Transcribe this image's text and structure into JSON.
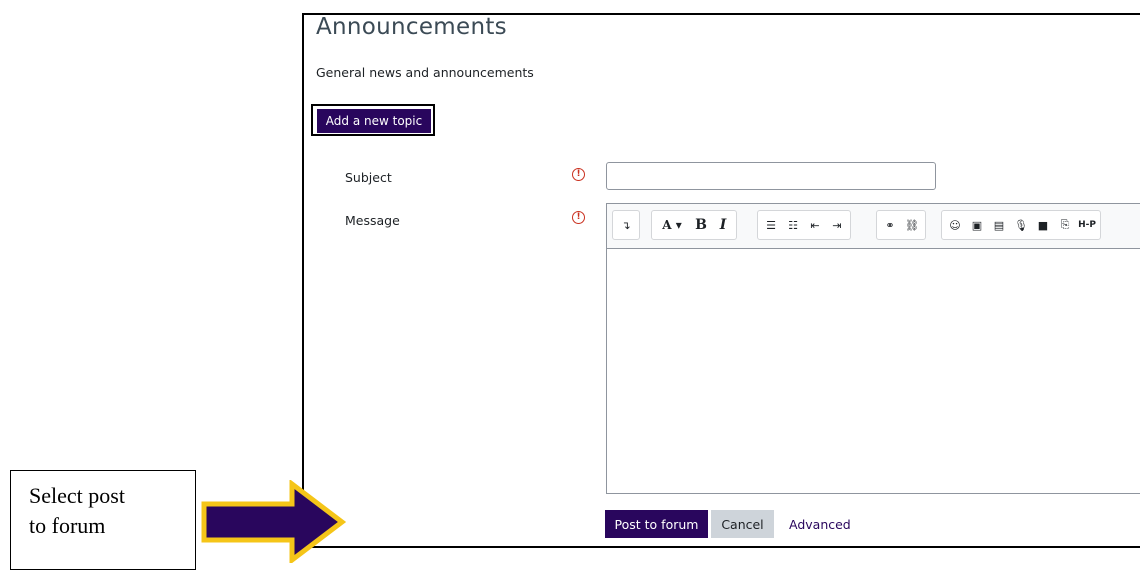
{
  "page": {
    "title": "Announcements",
    "description": "General news and announcements"
  },
  "actions": {
    "add_topic_label": "Add a new topic"
  },
  "form": {
    "subject_label": "Subject",
    "subject_value": "",
    "message_label": "Message",
    "required_icon": "exclamation-circle-icon",
    "required_color": "#ca3120"
  },
  "editor": {
    "toolbar_groups": [
      {
        "name": "collapse",
        "buttons": [
          {
            "icon": "collapse-icon",
            "glyph": "↴"
          }
        ]
      },
      {
        "name": "format",
        "buttons": [
          {
            "icon": "font-style-icon",
            "glyph": "A ▾"
          },
          {
            "icon": "bold-icon",
            "glyph": "B"
          },
          {
            "icon": "italic-icon",
            "glyph": "I"
          }
        ]
      },
      {
        "name": "lists",
        "buttons": [
          {
            "icon": "unordered-list-icon",
            "glyph": "☰"
          },
          {
            "icon": "ordered-list-icon",
            "glyph": "☷"
          },
          {
            "icon": "outdent-icon",
            "glyph": "⇤"
          },
          {
            "icon": "indent-icon",
            "glyph": "⇥"
          }
        ]
      },
      {
        "name": "links",
        "buttons": [
          {
            "icon": "link-icon",
            "glyph": "🔗"
          },
          {
            "icon": "unlink-icon",
            "glyph": "⛓"
          }
        ]
      },
      {
        "name": "media",
        "buttons": [
          {
            "icon": "emoji-icon",
            "glyph": "☺"
          },
          {
            "icon": "image-icon",
            "glyph": "▣"
          },
          {
            "icon": "media-icon",
            "glyph": "▤"
          },
          {
            "icon": "microphone-icon",
            "glyph": "🎙"
          },
          {
            "icon": "video-icon",
            "glyph": "■"
          },
          {
            "icon": "manage-files-icon",
            "glyph": "⎘"
          },
          {
            "icon": "h5p-icon",
            "glyph": "H-P"
          }
        ]
      }
    ]
  },
  "buttons": {
    "post_label": "Post to forum",
    "cancel_label": "Cancel",
    "advanced_label": "Advanced"
  },
  "callout": {
    "line1": "Select post",
    "line2": "to forum"
  },
  "colors": {
    "primary": "#29065d",
    "arrow_fill": "#29065d",
    "arrow_border": "#f5c518"
  }
}
